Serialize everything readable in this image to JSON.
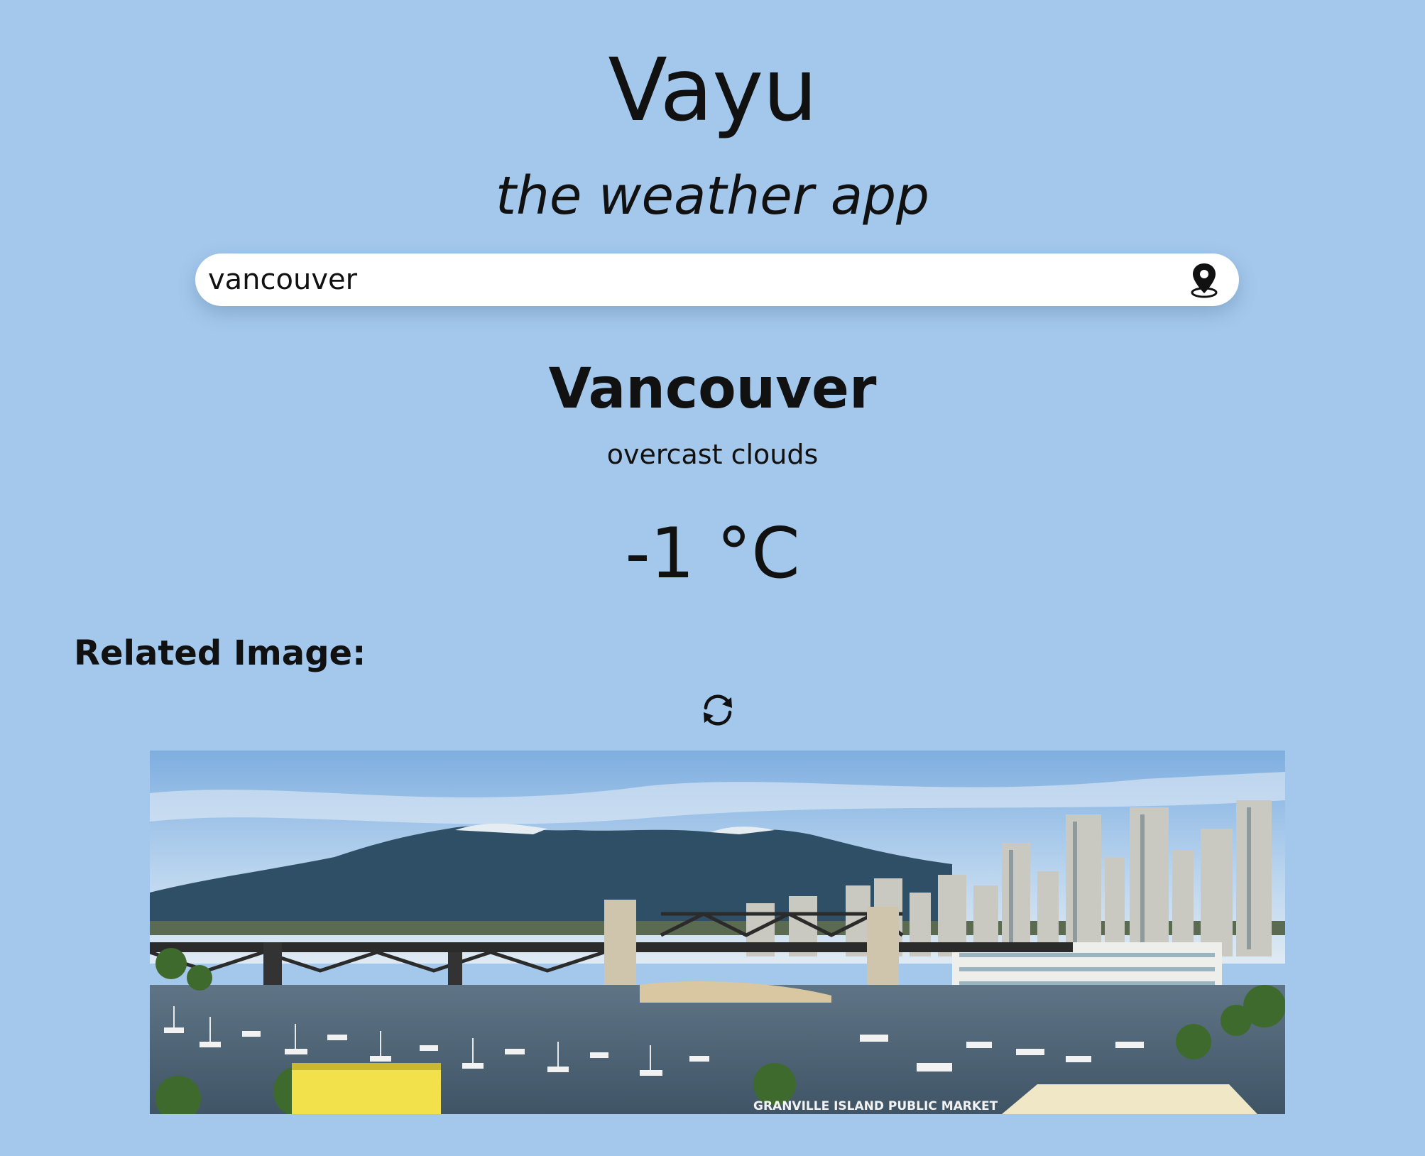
{
  "app": {
    "title": "Vayu",
    "subtitle": "the weather app"
  },
  "search": {
    "value": "vancouver",
    "icon": "location-pin-icon"
  },
  "weather": {
    "city": "Vancouver",
    "condition": "overcast clouds",
    "temperature": "-1 °C"
  },
  "related": {
    "heading": "Related Image:",
    "refresh_icon": "refresh-icon",
    "sign_text": "GRANVILLE ISLAND PUBLIC MARKET"
  },
  "colors": {
    "background": "#a3c8ec",
    "text": "#111111",
    "search_bg": "#ffffff"
  }
}
